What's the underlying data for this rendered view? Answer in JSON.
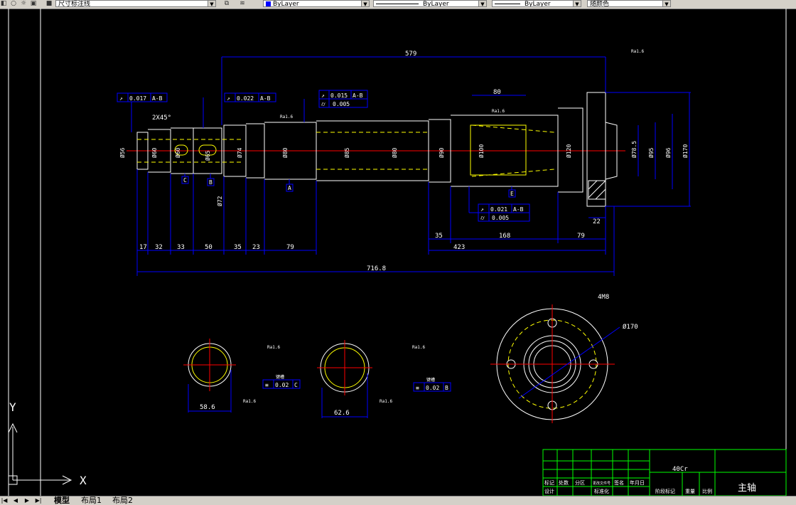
{
  "toolbar": {
    "dimstyle": "尺寸标注线",
    "layer": "ByLayer",
    "linetype": "ByLayer",
    "lineweight": "ByLayer",
    "plotstyle": "随颜色"
  },
  "tabs": [
    "模型",
    "布局1",
    "布局2"
  ],
  "ucs": {
    "x": "X",
    "y": "Y"
  },
  "drawing": {
    "dims": {
      "overall_upper": "579",
      "overall_lower": "716.8",
      "seg17": "17",
      "seg32": "32",
      "seg33": "33",
      "seg50": "50",
      "seg35a": "35",
      "seg23": "23",
      "seg79a": "79",
      "seg35b": "35",
      "seg423": "423",
      "seg168": "168",
      "seg79b": "79",
      "len80": "80",
      "len22": "22",
      "chamfer": "2X45°",
      "d58_6": "58.6",
      "d62_6": "62.6",
      "d_holes": "4M8",
      "d_bolt": "Ø170"
    },
    "diameters": [
      "Ø56",
      "Ø60",
      "Ø60",
      "Ø65",
      "Ø74",
      "Ø80",
      "Ø85",
      "Ø80",
      "Ø90",
      "Ø100",
      "Ø120",
      "Ø78.5",
      "Ø95",
      "Ø96",
      "Ø170",
      "Ø72"
    ],
    "gdt": {
      "g1": {
        "sym": "↗",
        "val": "0.017",
        "ref": "A-B"
      },
      "g2": {
        "sym": "↗",
        "val": "0.022",
        "ref": "A-B"
      },
      "g3a": {
        "sym": "↗",
        "val": "0.015",
        "ref": "A-B"
      },
      "g3b": {
        "sym": "⌭",
        "val": "0.005",
        "ref": ""
      },
      "g4a": {
        "sym": "↗",
        "val": "0.021",
        "ref": "A-B"
      },
      "g4b": {
        "sym": "⌭",
        "val": "0.005",
        "ref": ""
      },
      "g5": {
        "sym": "≡",
        "val": "0.02",
        "ref": "C"
      },
      "g6": {
        "sym": "≡",
        "val": "0.02",
        "ref": "B"
      }
    },
    "datums": {
      "a": "A",
      "b": "B",
      "c": "C",
      "e": "E"
    },
    "rough": "Ra1.6",
    "key_label1": "键槽",
    "key_label2": "键槽"
  },
  "title_block": {
    "material": "40Cr",
    "part_name": "主轴",
    "cells": [
      "标记",
      "处数",
      "分区",
      "更改文件号",
      "签名",
      "年月日",
      "设计",
      "标准化",
      "阶段标记",
      "重量",
      "比例"
    ]
  }
}
